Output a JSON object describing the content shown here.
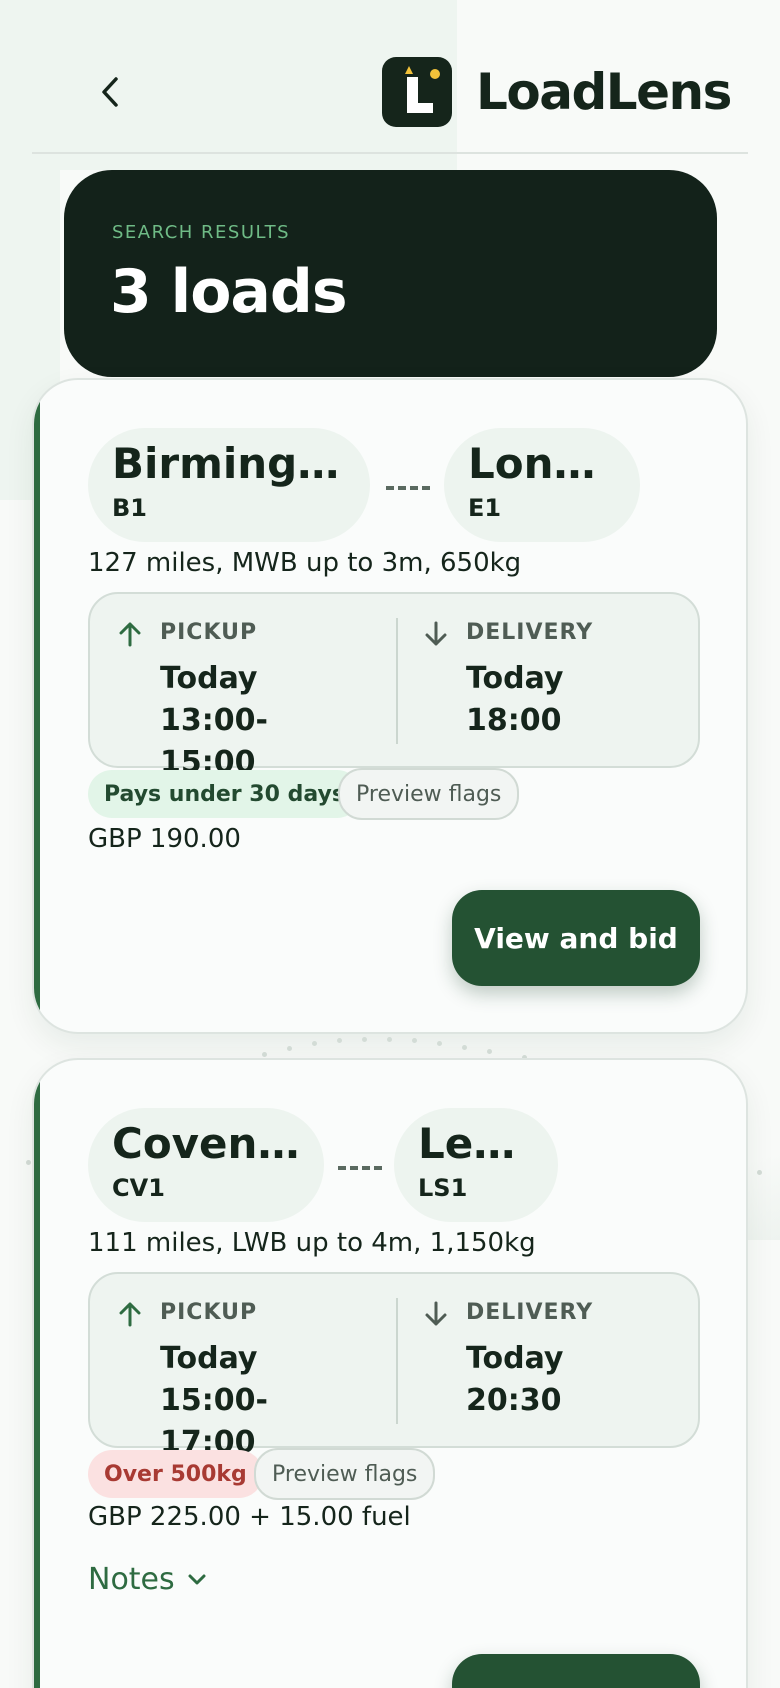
{
  "brand": {
    "name": "LoadLens",
    "accent": "#2e6b41",
    "dark": "#13221a"
  },
  "header": {
    "back_icon": "chevron-left-icon",
    "logo_icon": "loadlens-logo-icon"
  },
  "hero": {
    "eyebrow": "SEARCH RESULTS",
    "title": "3 loads"
  },
  "loads": [
    {
      "origin": {
        "city": "Birmingha...",
        "postcode": "B1"
      },
      "destination": {
        "city": "London",
        "postcode": "E1"
      },
      "meta": "127 miles, MWB up to 3m, 650kg",
      "pickup": {
        "label": "PICKUP",
        "value_line1": "Today 13:00-",
        "value_line2": "15:00"
      },
      "delivery": {
        "label": "DELIVERY",
        "value_line1": "Today 18:00"
      },
      "tags": [
        {
          "label": "Pays under 30 days",
          "kind": "good"
        }
      ],
      "preview_label": "Preview flags",
      "price": "GBP 190.00",
      "cta": "View and bid"
    },
    {
      "origin": {
        "city": "Coventry",
        "postcode": "CV1"
      },
      "destination": {
        "city": "Leeds",
        "postcode": "LS1"
      },
      "meta": "111 miles, LWB up to 4m, 1,150kg",
      "pickup": {
        "label": "PICKUP",
        "value_line1": "Today 15:00-",
        "value_line2": "17:00"
      },
      "delivery": {
        "label": "DELIVERY",
        "value_line1": "Today 20:30"
      },
      "tags": [
        {
          "label": "Over 500kg",
          "kind": "warn"
        }
      ],
      "preview_label": "Preview flags",
      "price": "GBP 225.00 + 15.00 fuel",
      "notes_label": "Notes"
    }
  ]
}
